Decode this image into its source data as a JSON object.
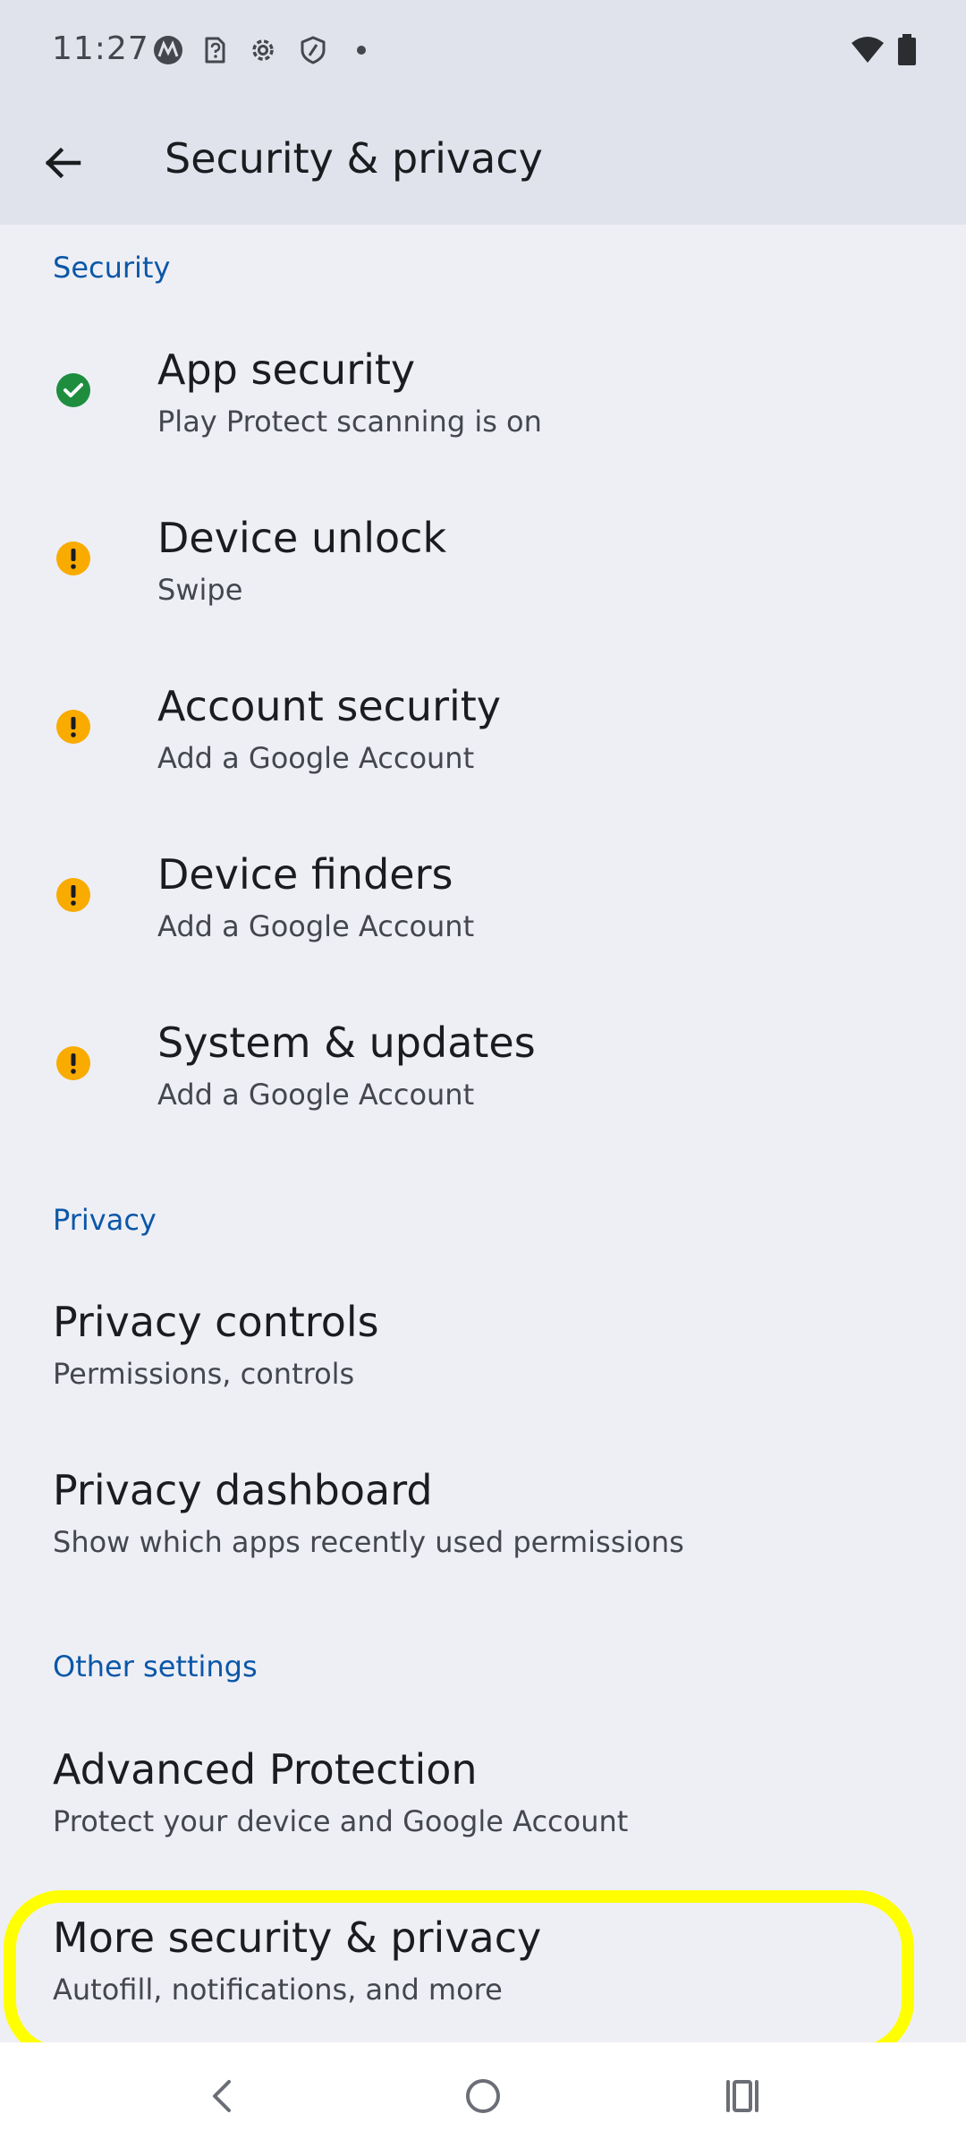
{
  "status_bar": {
    "time": "11:27",
    "left_icons": [
      "motorola-icon",
      "sim-question-icon",
      "settings-gear-icon",
      "shield-icon",
      "dot-icon"
    ],
    "right_icons": [
      "wifi-icon",
      "battery-icon"
    ]
  },
  "app_bar": {
    "title": "Security & privacy",
    "back_icon": "arrow-back-icon"
  },
  "sections": {
    "security": {
      "header": "Security",
      "items": [
        {
          "title": "App security",
          "subtitle": "Play Protect scanning is on",
          "status": "ok"
        },
        {
          "title": "Device unlock",
          "subtitle": "Swipe",
          "status": "warning"
        },
        {
          "title": "Account security",
          "subtitle": "Add a Google Account",
          "status": "warning"
        },
        {
          "title": "Device finders",
          "subtitle": "Add a Google Account",
          "status": "warning"
        },
        {
          "title": "System & updates",
          "subtitle": "Add a Google Account",
          "status": "warning"
        }
      ]
    },
    "privacy": {
      "header": "Privacy",
      "items": [
        {
          "title": "Privacy controls",
          "subtitle": "Permissions, controls"
        },
        {
          "title": "Privacy dashboard",
          "subtitle": "Show which apps recently used permissions"
        }
      ]
    },
    "other": {
      "header": "Other settings",
      "items": [
        {
          "title": "Advanced Protection",
          "subtitle": "Protect your device and Google Account"
        },
        {
          "title": "More security & privacy",
          "subtitle": "Autofill, notifications, and more"
        }
      ]
    }
  },
  "colors": {
    "ok_green": "#1e8e3e",
    "warning_yellow": "#f9ab00",
    "accent_blue": "#0b57a8",
    "highlight_yellow": "#ffff00"
  },
  "nav_bar": {
    "icons": [
      "nav-back-icon",
      "nav-home-icon",
      "nav-recents-icon"
    ]
  }
}
